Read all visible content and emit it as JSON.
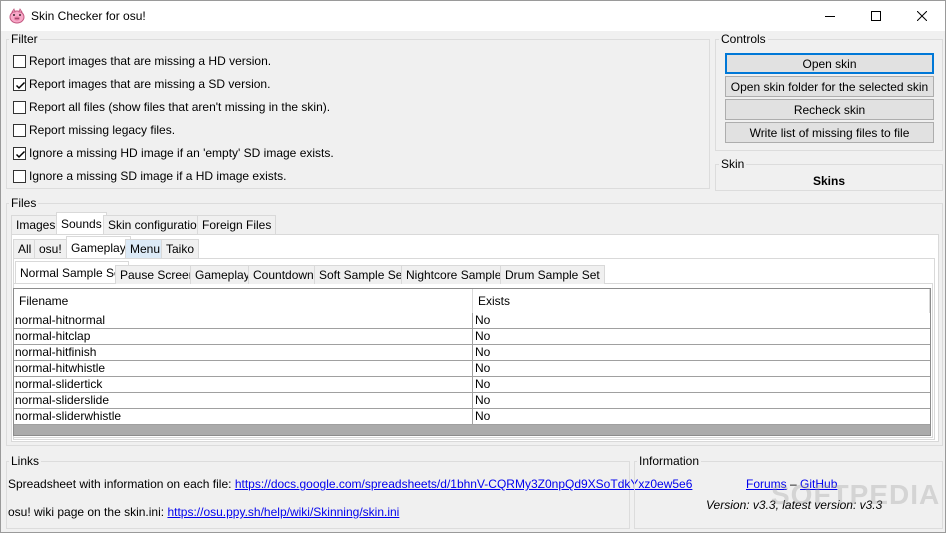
{
  "window": {
    "title": "Skin Checker for osu!"
  },
  "filter": {
    "label": "Filter",
    "options": [
      {
        "label": "Report images that are missing a HD version.",
        "checked": false
      },
      {
        "label": "Report images that are missing a SD version.",
        "checked": true
      },
      {
        "label": "Report all files (show files that aren't missing in the skin).",
        "checked": false
      },
      {
        "label": "Report missing legacy files.",
        "checked": false
      },
      {
        "label": "Ignore a missing HD image if an 'empty' SD image exists.",
        "checked": true
      },
      {
        "label": "Ignore a missing SD image if a HD image exists.",
        "checked": false
      }
    ]
  },
  "controls": {
    "label": "Controls",
    "buttons": [
      "Open skin",
      "Open skin folder for the selected skin",
      "Recheck skin",
      "Write list of missing files to file"
    ]
  },
  "skin": {
    "label": "Skin",
    "value": "Skins"
  },
  "files": {
    "label": "Files",
    "tabs": [
      "Images",
      "Sounds",
      "Skin configuration",
      "Foreign Files"
    ],
    "mode_tabs": [
      "All",
      "osu!",
      "Gameplay",
      "Menu",
      "Taiko"
    ],
    "sub_tabs": [
      "Normal Sample Set",
      "Pause Screen",
      "Gameplay",
      "Countdown",
      "Soft Sample Set",
      "Nightcore Samples",
      "Drum Sample Set"
    ],
    "columns": [
      "Filename",
      "Exists"
    ],
    "rows": [
      [
        "normal-hitnormal",
        "No"
      ],
      [
        "normal-hitclap",
        "No"
      ],
      [
        "normal-hitfinish",
        "No"
      ],
      [
        "normal-hitwhistle",
        "No"
      ],
      [
        "normal-slidertick",
        "No"
      ],
      [
        "normal-sliderslide",
        "No"
      ],
      [
        "normal-sliderwhistle",
        "No"
      ]
    ]
  },
  "links": {
    "label": "Links",
    "spreadsheet_text": "Spreadsheet with information on each file:",
    "spreadsheet_url": "https://docs.google.com/spreadsheets/d/1bhnV-CQRMy3Z0npQd9XSoTdkYxz0ew5e6",
    "wiki_text": "osu! wiki page on the skin.ini:",
    "wiki_url": "https://osu.ppy.sh/help/wiki/Skinning/skin.ini"
  },
  "information": {
    "label": "Information",
    "forums": "Forums",
    "separator": "–",
    "github": "GitHub",
    "version": "Version: v3.3, latest version: v3.3"
  },
  "watermark": "SOFTPEDIA"
}
